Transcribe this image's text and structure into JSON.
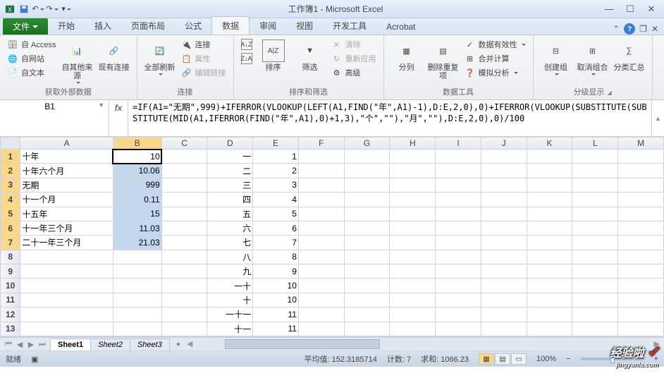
{
  "title": "工作簿1 - Microsoft Excel",
  "ribbon": {
    "file": "文件",
    "tabs": [
      "开始",
      "插入",
      "页面布局",
      "公式",
      "数据",
      "审阅",
      "视图",
      "开发工具",
      "Acrobat"
    ],
    "active_tab": "数据"
  },
  "groups": {
    "g1": {
      "label": "获取外部数据",
      "from_access": "自 Access",
      "from_web": "自网站",
      "from_text": "自文本",
      "other": "自其他来源",
      "existing": "现有连接"
    },
    "g2": {
      "label": "连接",
      "refresh": "全部刷新",
      "connections": "连接",
      "properties": "属性",
      "edit_links": "编辑链接"
    },
    "g3": {
      "label": "排序和筛选",
      "sort": "排序",
      "filter": "筛选",
      "clear": "清除",
      "reapply": "重新应用",
      "advanced": "高级"
    },
    "g4": {
      "label": "数据工具",
      "text_to_col": "分列",
      "remove_dup": "删除重复项",
      "validation": "数据有效性",
      "consolidate": "合并计算",
      "whatif": "模拟分析"
    },
    "g5": {
      "label": "分级显示",
      "group": "创建组",
      "ungroup": "取消组合",
      "subtotal": "分类汇总"
    }
  },
  "name_box": "B1",
  "formula": "=IF(A1=\"无期\",999)+IFERROR(VLOOKUP(LEFT(A1,FIND(\"年\",A1)-1),D:E,2,0),0)+IFERROR(VLOOKUP(SUBSTITUTE(SUBSTITUTE(MID(A1,IFERROR(FIND(\"年\",A1),0)+1,3),\"个\",\"\"),\"月\",\"\"),D:E,2,0),0)/100",
  "columns": [
    "A",
    "B",
    "C",
    "D",
    "E",
    "F",
    "G",
    "H",
    "I",
    "J",
    "K",
    "L",
    "M"
  ],
  "rows": [
    {
      "r": "1",
      "A": "十年",
      "B": "10",
      "D": "一",
      "E": "1"
    },
    {
      "r": "2",
      "A": "十年六个月",
      "B": "10.06",
      "D": "二",
      "E": "2"
    },
    {
      "r": "3",
      "A": "无期",
      "B": "999",
      "D": "三",
      "E": "3"
    },
    {
      "r": "4",
      "A": "十一个月",
      "B": "0.11",
      "D": "四",
      "E": "4"
    },
    {
      "r": "5",
      "A": "十五年",
      "B": "15",
      "D": "五",
      "E": "5"
    },
    {
      "r": "6",
      "A": "十一年三个月",
      "B": "11.03",
      "D": "六",
      "E": "6"
    },
    {
      "r": "7",
      "A": "二十一年三个月",
      "B": "21.03",
      "D": "七",
      "E": "7"
    },
    {
      "r": "8",
      "A": "",
      "B": "",
      "D": "八",
      "E": "8"
    },
    {
      "r": "9",
      "A": "",
      "B": "",
      "D": "九",
      "E": "9"
    },
    {
      "r": "10",
      "A": "",
      "B": "",
      "D": "一十",
      "E": "10"
    },
    {
      "r": "11",
      "A": "",
      "B": "",
      "D": "十",
      "E": "10"
    },
    {
      "r": "12",
      "A": "",
      "B": "",
      "D": "一十一",
      "E": "11"
    },
    {
      "r": "13",
      "A": "",
      "B": "",
      "D": "十一",
      "E": "11"
    }
  ],
  "sheets": [
    "Sheet1",
    "Sheet2",
    "Sheet3"
  ],
  "status": {
    "ready": "就绪",
    "avg_label": "平均值:",
    "avg": "152.3185714",
    "count_label": "计数:",
    "count": "7",
    "sum_label": "求和:",
    "sum": "1066.23",
    "zoom": "100%"
  },
  "watermark": {
    "text": "经验啦",
    "url": "jingyanla.com"
  }
}
